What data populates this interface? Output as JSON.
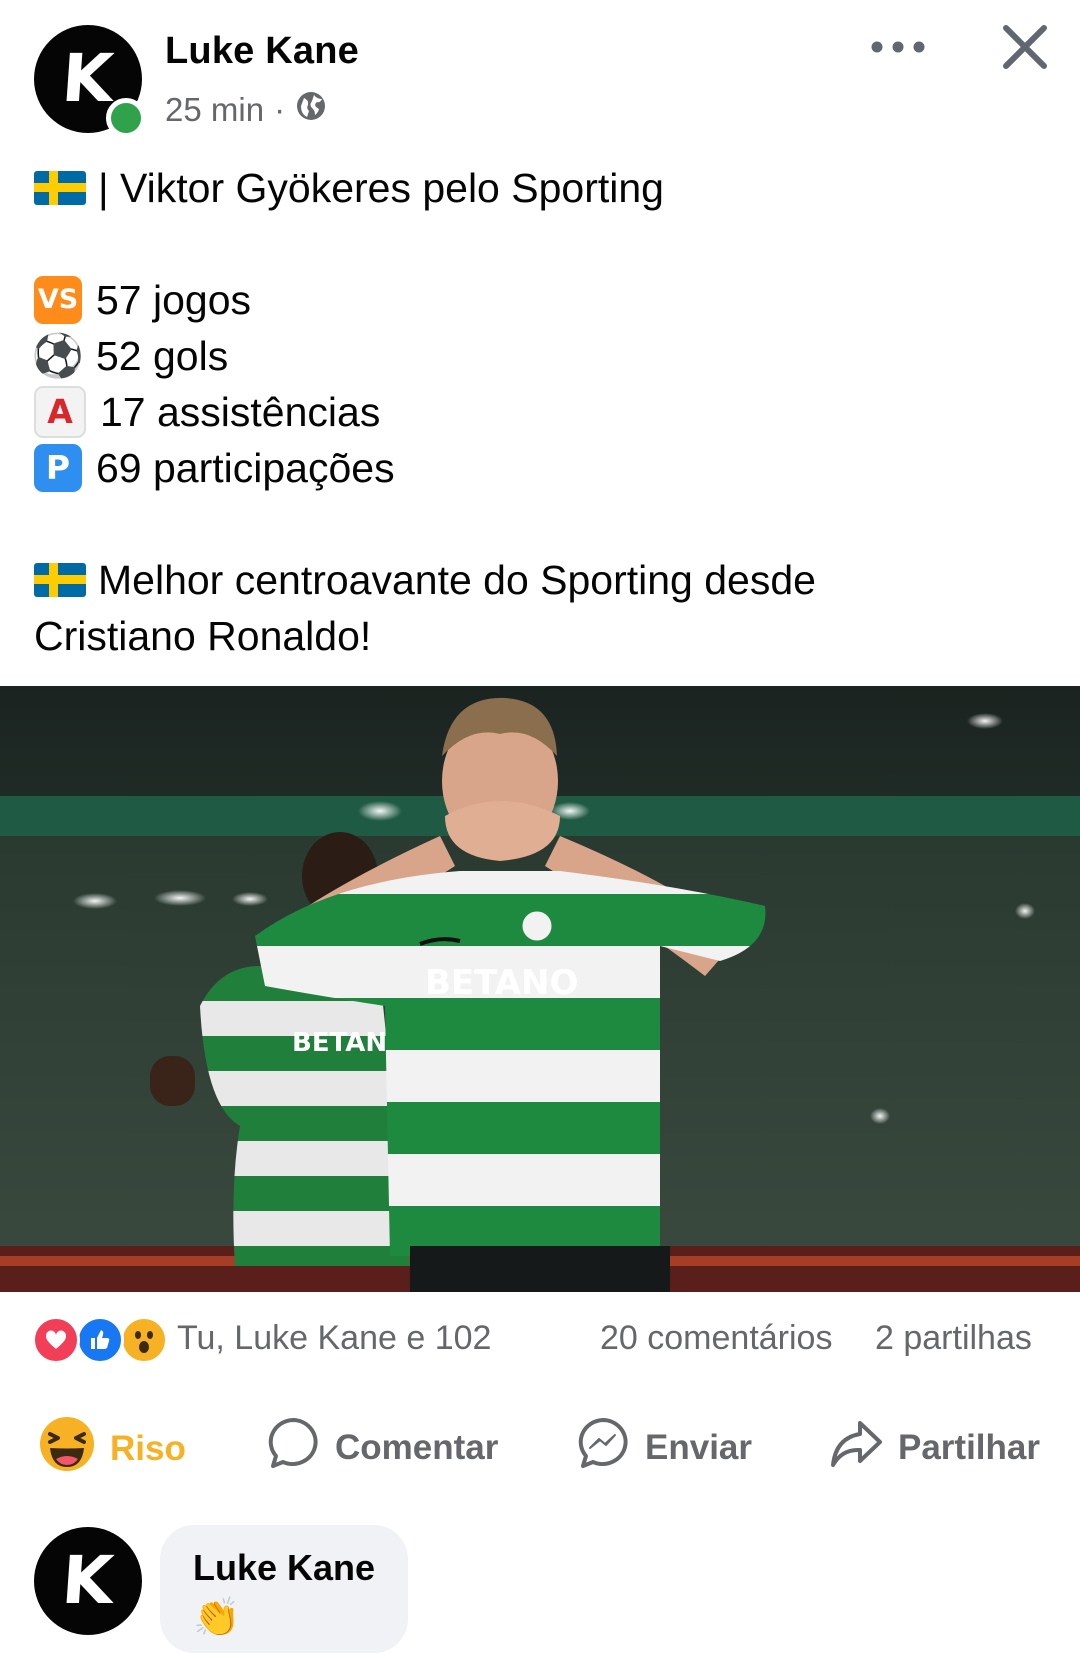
{
  "post": {
    "author": "Luke Kane",
    "avatar_letter": "K",
    "time": "25 min",
    "separator": "·",
    "audience_icon": "globe-icon",
    "more_icon": "more-options-icon",
    "close_icon": "close-icon",
    "lines": {
      "title": "| Viktor Gyökeres pelo Sporting",
      "games": "57 jogos",
      "goals": "52 gols",
      "assists": "17 assistências",
      "participations": "69 participações",
      "best_1": "Melhor centroavante do Sporting desde",
      "best_2": "Cristiano Ronaldo!"
    },
    "emoji": {
      "vs": "VS",
      "ball": "⚽",
      "a": "A",
      "p": "P"
    },
    "image": {
      "sponsor_main": "BETANO",
      "sponsor_back": "BETANO"
    }
  },
  "reactions": {
    "summary": "Tu, Luke Kane e 102",
    "comments": "20 comentários",
    "shares": "2 partilhas",
    "colors": {
      "love": "#f33e58",
      "like": "#1877f2",
      "wow": "#f7b125"
    }
  },
  "actions": {
    "react_label": "Riso",
    "react_color": "#f7b125",
    "comment_label": "Comentar",
    "send_label": "Enviar",
    "share_label": "Partilhar"
  },
  "comment": {
    "author": "Luke Kane",
    "avatar_letter": "K",
    "content": "👏"
  }
}
